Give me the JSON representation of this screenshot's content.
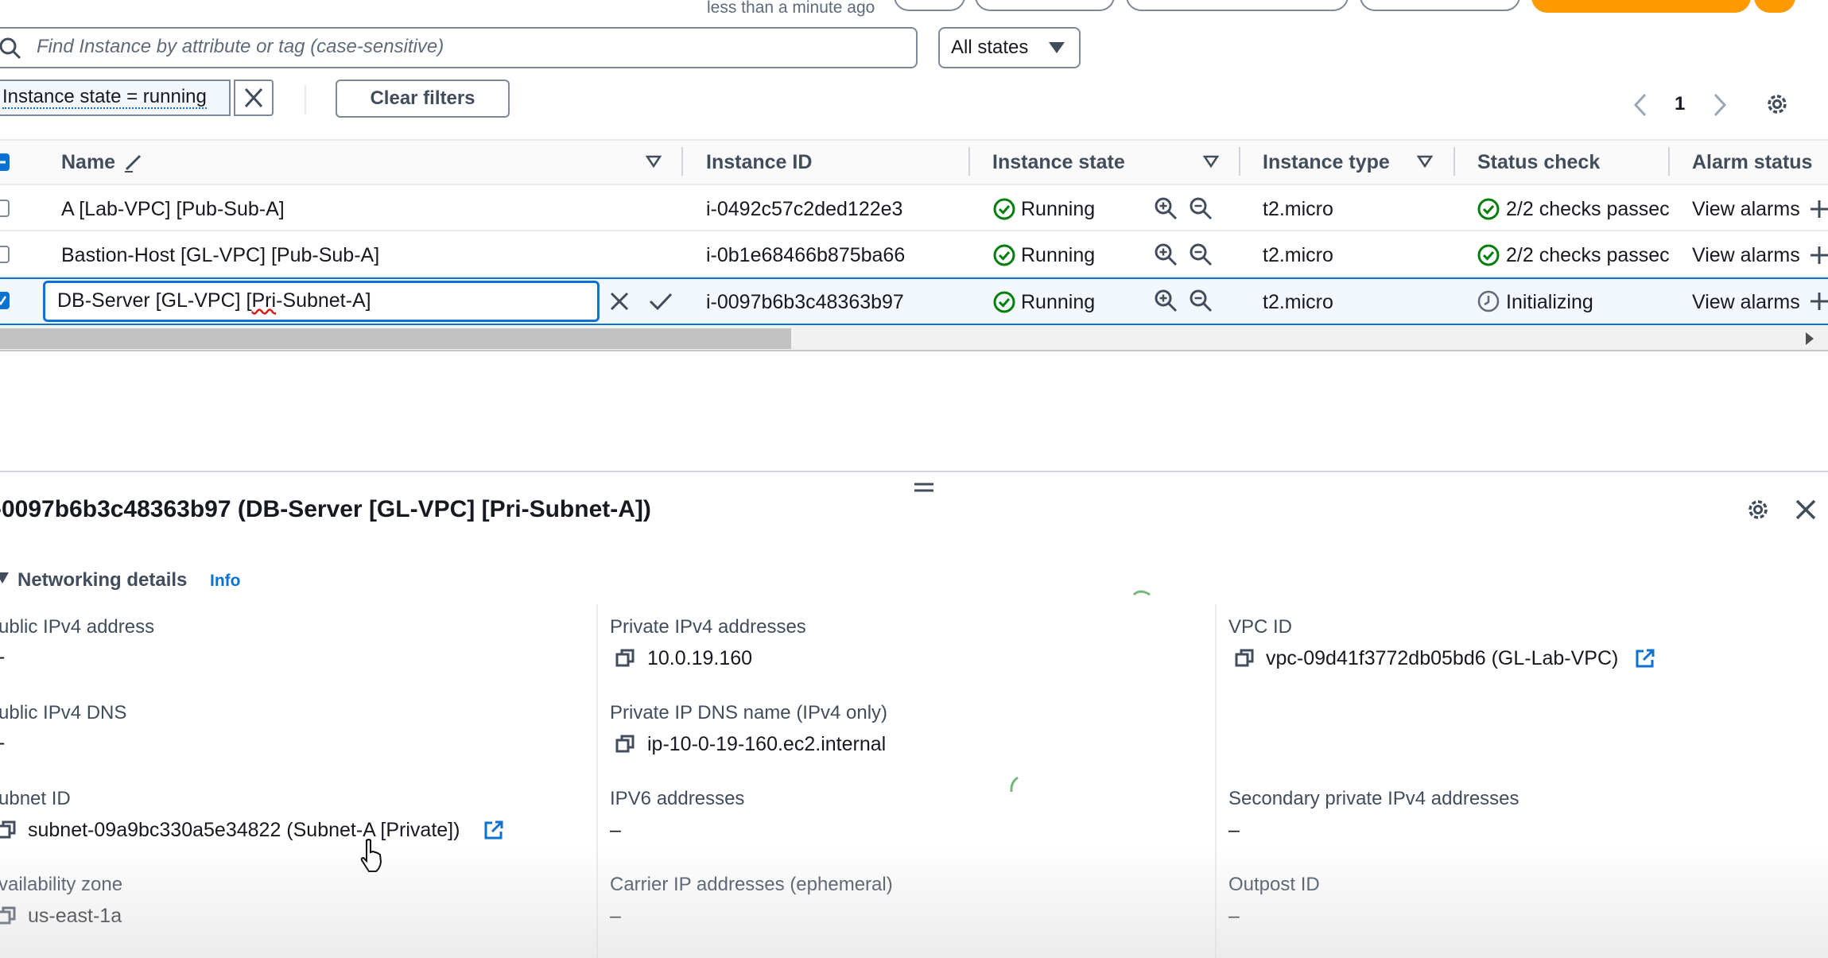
{
  "top": {
    "refresh_text": "less than a minute ago"
  },
  "filter": {
    "search_placeholder": "Find Instance by attribute or tag (case-sensitive)",
    "states_select": "All states",
    "token": "Instance state = running",
    "clear_filters": "Clear filters",
    "page": "1"
  },
  "table": {
    "headers": {
      "name": "Name",
      "instance_id": "Instance ID",
      "instance_state": "Instance state",
      "instance_type": "Instance type",
      "status_check": "Status check",
      "alarm_status": "Alarm status"
    },
    "rows": [
      {
        "name": "A [Lab-VPC] [Pub-Sub-A]",
        "id": "i-0492c57c2ded122e3",
        "state": "Running",
        "type": "t2.micro",
        "status": "2/2 checks passec",
        "alarm": "View alarms"
      },
      {
        "name": "Bastion-Host [GL-VPC] [Pub-Sub-A]",
        "id": "i-0b1e68466b875ba66",
        "state": "Running",
        "type": "t2.micro",
        "status": "2/2 checks passec",
        "alarm": "View alarms"
      },
      {
        "name_prefix": "DB-Server [GL-VPC] [",
        "name_misspelled": "Pri",
        "name_suffix": "-Subnet-A]",
        "id": "i-0097b6b3c48363b97",
        "state": "Running",
        "type": "t2.micro",
        "status": "Initializing",
        "alarm": "View alarms"
      }
    ]
  },
  "details": {
    "title": "-0097b6b3c48363b97 (DB-Server [GL-VPC] [Pri-Subnet-A])",
    "section": "Networking details",
    "info": "Info",
    "fields": {
      "public_ipv4": {
        "label": "ublic IPv4 address",
        "value": "-"
      },
      "public_dns": {
        "label": "ublic IPv4 DNS",
        "value": "-"
      },
      "subnet": {
        "label": "ubnet ID",
        "value": "subnet-09a9bc330a5e34822 (Subnet-A [Private])"
      },
      "az": {
        "label": "vailability zone",
        "value": "us-east-1a"
      },
      "private_ipv4": {
        "label": "Private IPv4 addresses",
        "value": "10.0.19.160"
      },
      "private_dns": {
        "label": "Private IP DNS name (IPv4 only)",
        "value": "ip-10-0-19-160.ec2.internal"
      },
      "ipv6": {
        "label": "IPV6 addresses",
        "value": "–"
      },
      "carrier": {
        "label": "Carrier IP addresses (ephemeral)",
        "value": "–"
      },
      "vpc": {
        "label": "VPC ID",
        "value": "vpc-09d41f3772db05bd6 (GL-Lab-VPC)"
      },
      "secondary": {
        "label": "Secondary private IPv4 addresses",
        "value": "–"
      },
      "outpost": {
        "label": "Outpost ID",
        "value": "–"
      }
    }
  },
  "colors": {
    "link": "#0972d3",
    "success": "#037f0c",
    "accent": "#ff9900"
  }
}
